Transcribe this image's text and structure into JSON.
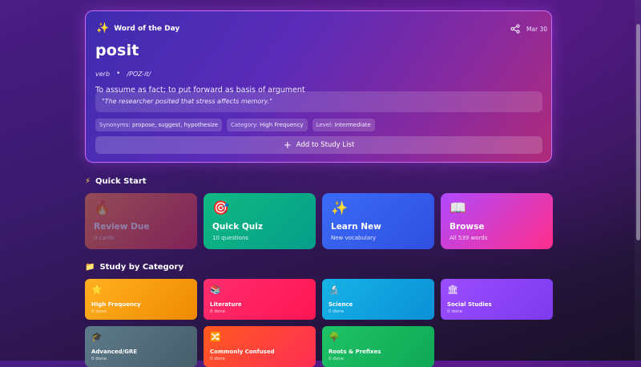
{
  "word_of_day": {
    "header_label": "Word of the Day",
    "date": "Mar 30",
    "word": "posit",
    "part_of_speech": "verb",
    "pronunciation": "/POZ-it/",
    "definition": "To assume as fact; to put forward as basis of argument",
    "example": "\"The researcher posited that stress affects memory.\"",
    "tags": [
      {
        "key": "Synonyms:",
        "value": "propose, suggest, hypothesize"
      },
      {
        "key": "Category:",
        "value": "High Frequency"
      },
      {
        "key": "Level:",
        "value": "Intermediate"
      }
    ],
    "add_button_label": "Add to Study List",
    "icons": {
      "header": "sparkles-icon",
      "share": "share-icon",
      "add": "plus-icon"
    }
  },
  "quick_start": {
    "title": "Quick Start",
    "cards": [
      {
        "title": "Review Due",
        "subtitle": "0 cards",
        "icon": "fire-icon",
        "color_from": "#ff8a3d",
        "color_to": "#e0305a",
        "disabled": true
      },
      {
        "title": "Quick Quiz",
        "subtitle": "10 questions",
        "icon": "target-icon",
        "color_from": "#10b981",
        "color_to": "#059e8a",
        "disabled": false
      },
      {
        "title": "Learn New",
        "subtitle": "New vocabulary",
        "icon": "sparkles-icon",
        "color_from": "#3b6cf6",
        "color_to": "#2f4fe0",
        "disabled": false
      },
      {
        "title": "Browse",
        "subtitle": "All 539 words",
        "icon": "book-icon",
        "color_from": "#b04aff",
        "color_to": "#ff2d8a",
        "disabled": false
      }
    ]
  },
  "categories": {
    "title": "Study by Category",
    "items": [
      {
        "title": "High Frequency",
        "subtitle": "0 done",
        "icon": "star-icon",
        "color_from": "#ffb020",
        "color_to": "#f08a00"
      },
      {
        "title": "Literature",
        "subtitle": "0 done",
        "icon": "books-icon",
        "color_from": "#ff2d6f",
        "color_to": "#ff1553"
      },
      {
        "title": "Science",
        "subtitle": "0 done",
        "icon": "microscope-icon",
        "color_from": "#16b4e6",
        "color_to": "#0a8fd6"
      },
      {
        "title": "Social Studies",
        "subtitle": "0 done",
        "icon": "classical-building-icon",
        "color_from": "#9b4dff",
        "color_to": "#7c3aed"
      },
      {
        "title": "Advanced/GRE",
        "subtitle": "0 done",
        "icon": "graduation-cap-icon",
        "color_from": "#5d7a8a",
        "color_to": "#475e6b"
      },
      {
        "title": "Commonly Confused",
        "subtitle": "0 done",
        "icon": "shuffle-icon",
        "color_from": "#ff5a1f",
        "color_to": "#ff2d55"
      },
      {
        "title": "Roots & Prefixes",
        "subtitle": "0 done",
        "icon": "tree-icon",
        "color_from": "#1fc266",
        "color_to": "#0fa855"
      }
    ]
  },
  "colors": {
    "background_top": "#4a1d86",
    "background_bottom": "#171126",
    "card_border": "#d878ff"
  }
}
